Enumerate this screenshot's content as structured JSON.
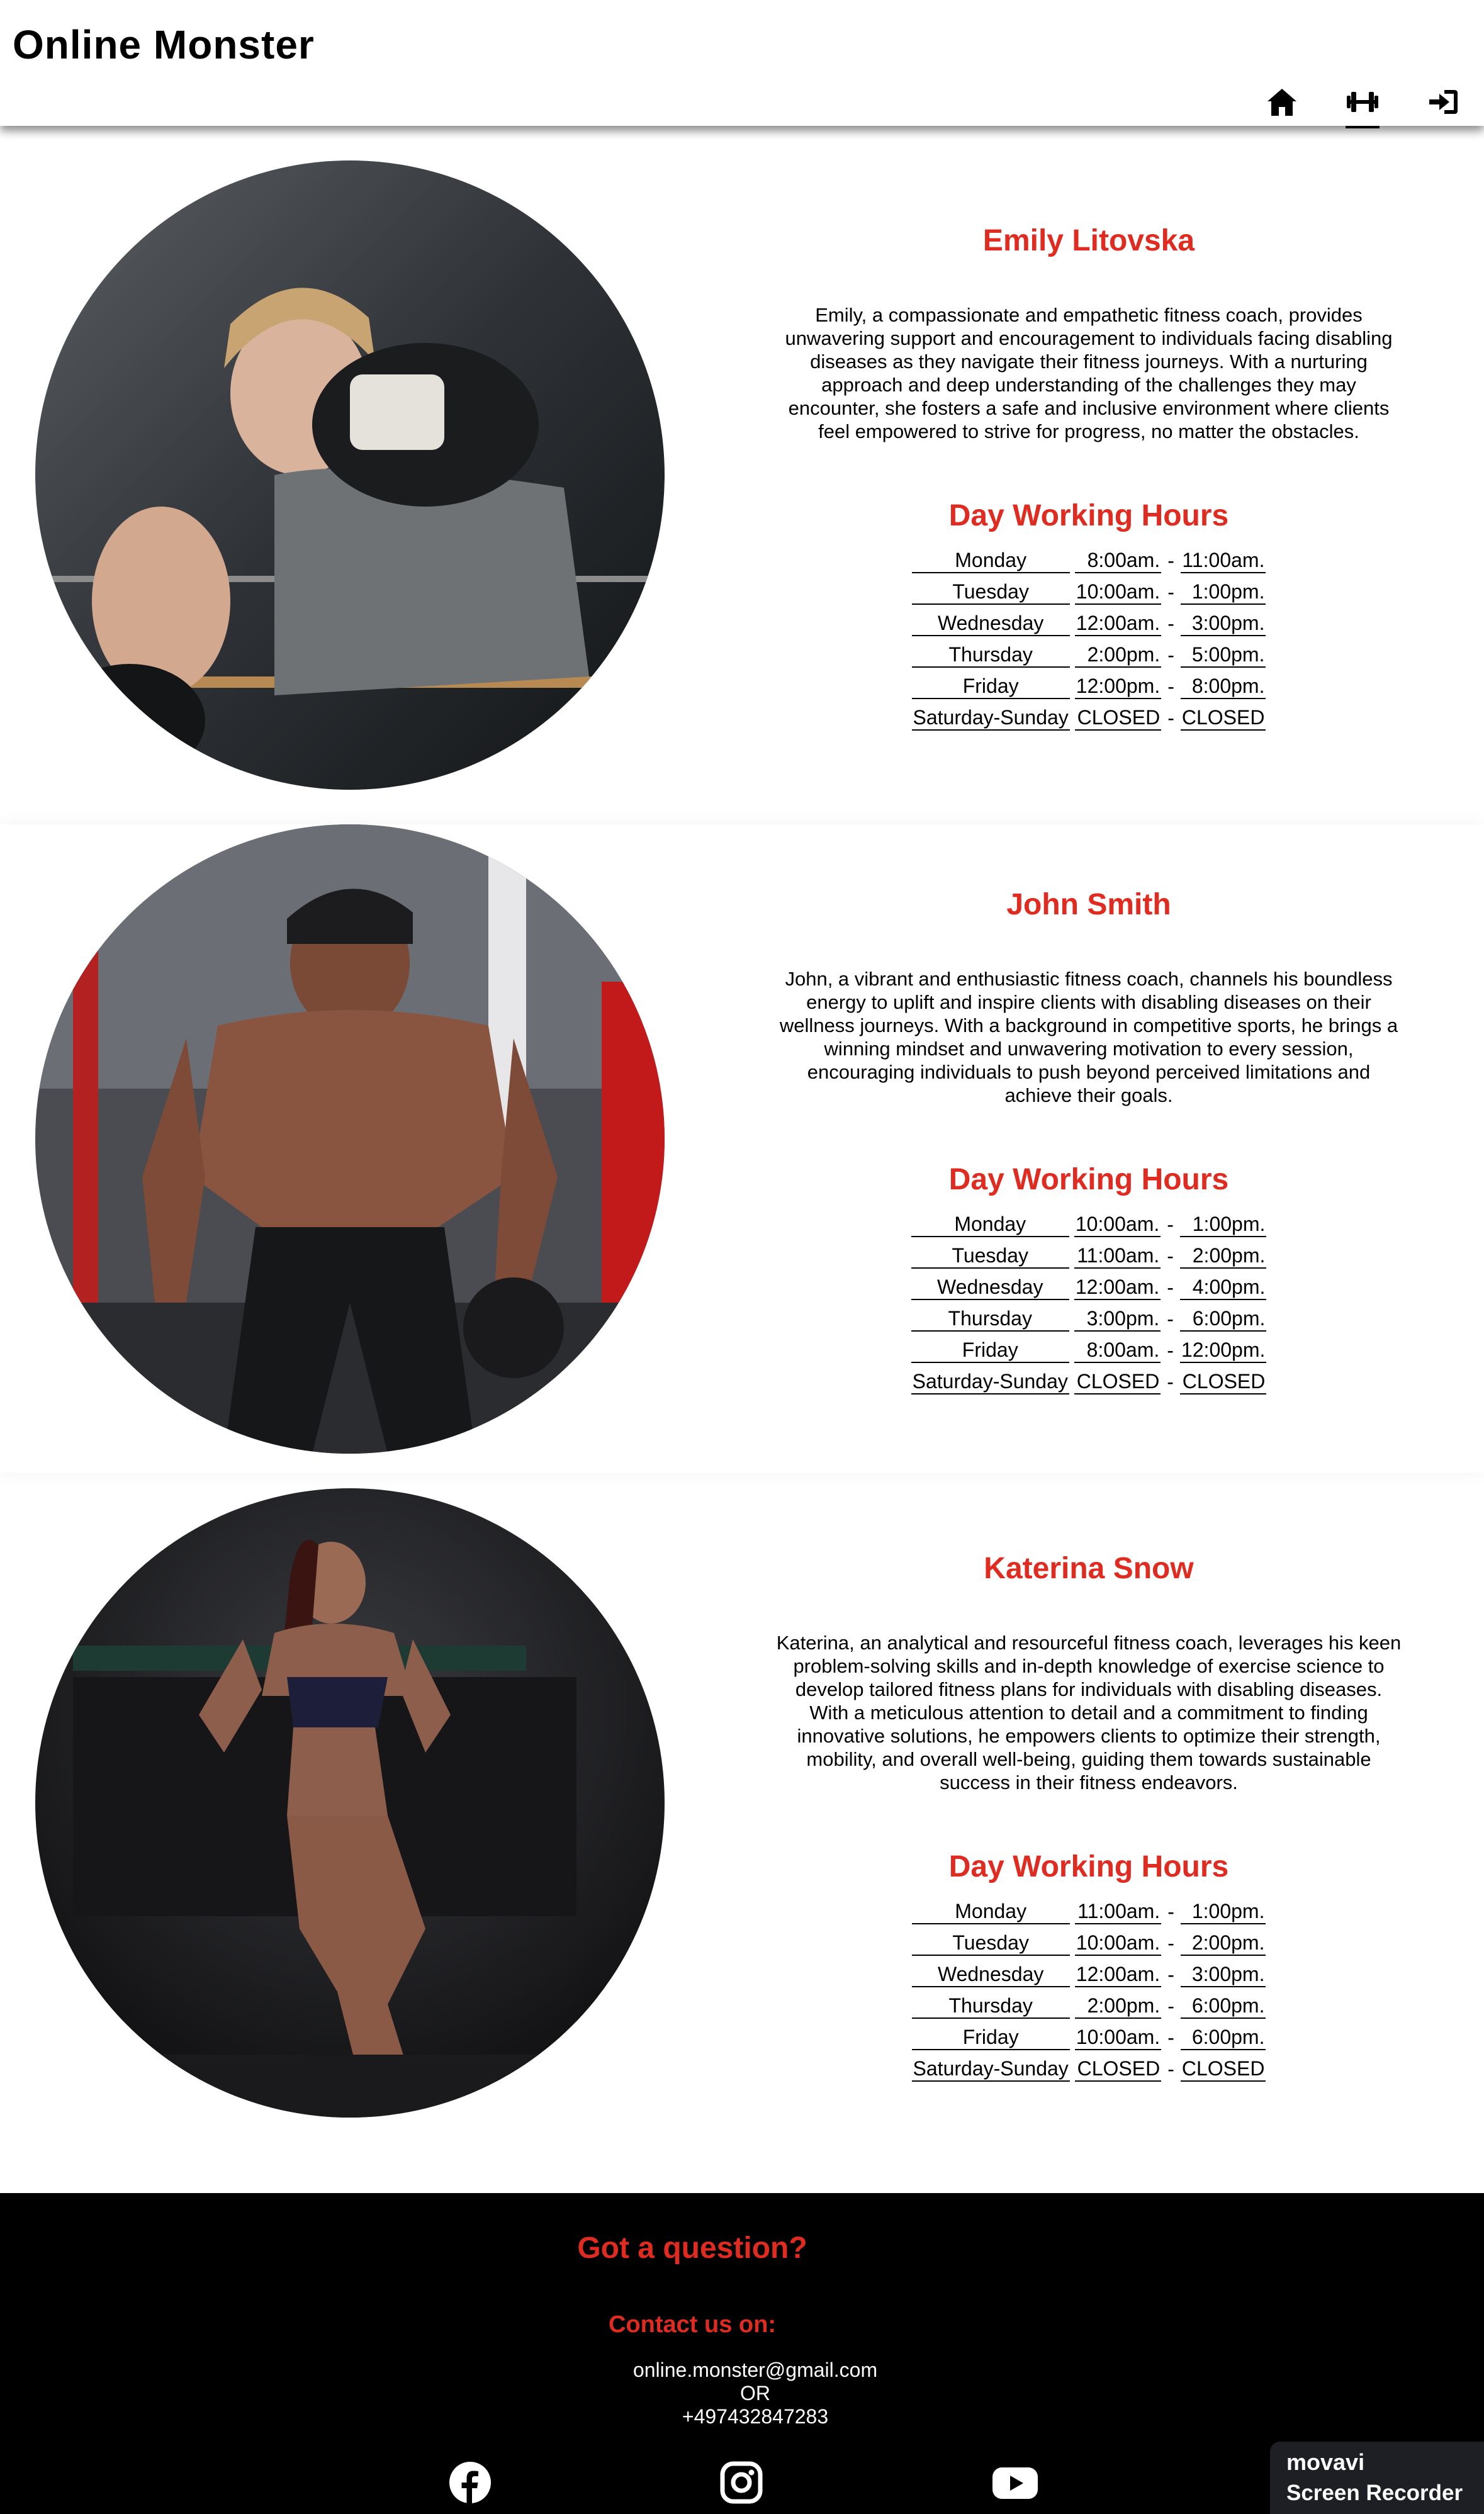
{
  "header": {
    "brand": "Online Monster",
    "nav": [
      {
        "icon": "home-icon"
      },
      {
        "icon": "dumbbell-icon",
        "active": true
      },
      {
        "icon": "sign-in-icon"
      }
    ]
  },
  "trainers": [
    {
      "name": "Emily Litovska",
      "bio": "Emily, a compassionate and empathetic fitness coach, provides unwavering support and encouragement to individuals facing disabling diseases as they navigate their fitness journeys. With a nurturing approach and deep understanding of the challenges they may encounter, she fosters a safe and inclusive environment where clients feel empowered to strive for progress, no matter the obstacles.",
      "hours_title": "Day Working Hours",
      "hours": [
        {
          "day": "Monday",
          "from": "8:00am.",
          "to": "11:00am."
        },
        {
          "day": "Tuesday",
          "from": "10:00am.",
          "to": "1:00pm."
        },
        {
          "day": "Wednesday",
          "from": "12:00am.",
          "to": "3:00pm."
        },
        {
          "day": "Thursday",
          "from": "2:00pm.",
          "to": "5:00pm."
        },
        {
          "day": "Friday",
          "from": "12:00pm.",
          "to": "8:00pm."
        },
        {
          "day": "Saturday-Sunday",
          "from": "CLOSED",
          "to": "CLOSED"
        }
      ]
    },
    {
      "name": "John Smith",
      "bio": "John, a vibrant and enthusiastic fitness coach, channels his boundless energy to uplift and inspire clients with disabling diseases on their wellness journeys. With a background in competitive sports, he brings a winning mindset and unwavering motivation to every session, encouraging individuals to push beyond perceived limitations and achieve their goals.",
      "hours_title": "Day Working Hours",
      "hours": [
        {
          "day": "Monday",
          "from": "10:00am.",
          "to": "1:00pm."
        },
        {
          "day": "Tuesday",
          "from": "11:00am.",
          "to": "2:00pm."
        },
        {
          "day": "Wednesday",
          "from": "12:00am.",
          "to": "4:00pm."
        },
        {
          "day": "Thursday",
          "from": "3:00pm.",
          "to": "6:00pm."
        },
        {
          "day": "Friday",
          "from": "8:00am.",
          "to": "12:00pm."
        },
        {
          "day": "Saturday-Sunday",
          "from": "CLOSED",
          "to": "CLOSED"
        }
      ]
    },
    {
      "name": "Katerina Snow",
      "bio": "Katerina, an analytical and resourceful fitness coach, leverages his keen problem-solving skills and in-depth knowledge of exercise science to develop tailored fitness plans for individuals with disabling diseases. With a meticulous attention to detail and a commitment to finding innovative solutions, he empowers clients to optimize their strength, mobility, and overall well-being, guiding them towards sustainable success in their fitness endeavors.",
      "hours_title": "Day Working Hours",
      "hours": [
        {
          "day": "Monday",
          "from": "11:00am.",
          "to": "1:00pm."
        },
        {
          "day": "Tuesday",
          "from": "10:00am.",
          "to": "2:00pm."
        },
        {
          "day": "Wednesday",
          "from": "12:00am.",
          "to": "3:00pm."
        },
        {
          "day": "Thursday",
          "from": "2:00pm.",
          "to": "6:00pm."
        },
        {
          "day": "Friday",
          "from": "10:00am.",
          "to": "6:00pm."
        },
        {
          "day": "Saturday-Sunday",
          "from": "CLOSED",
          "to": "CLOSED"
        }
      ]
    }
  ],
  "separator": "-",
  "footer": {
    "question": "Got a question?",
    "contact_title": "Contact us on:",
    "email": "online.monster@gmail.com",
    "or": "OR",
    "phone": "+497432847283",
    "social": [
      "facebook-icon",
      "instagram-icon",
      "youtube-icon"
    ]
  },
  "watermark": {
    "line1": "movavi",
    "line2": "Screen Recorder"
  },
  "colors": {
    "accent": "#e02b20",
    "footer_bg": "#000000"
  }
}
